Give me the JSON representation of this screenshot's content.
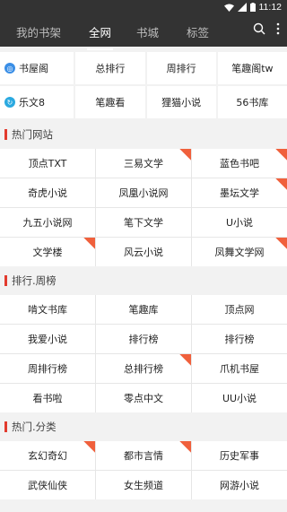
{
  "status": {
    "time": "11:12"
  },
  "nav": {
    "tabs": [
      {
        "label": "我的书架"
      },
      {
        "label": "全网"
      },
      {
        "label": "书城"
      },
      {
        "label": "标签"
      }
    ],
    "active_tab": "全网"
  },
  "quick": {
    "row1": [
      "书屋阁",
      "总排行",
      "周排行",
      "笔趣阁tw"
    ],
    "row2": [
      "乐文8",
      "笔趣看",
      "狸猫小说",
      "56书库"
    ]
  },
  "sections": [
    {
      "title": "热门网站",
      "items": [
        {
          "label": "顶点TXT",
          "hot": false
        },
        {
          "label": "三易文学",
          "hot": true
        },
        {
          "label": "蓝色书吧",
          "hot": true
        },
        {
          "label": "奇虎小说",
          "hot": false
        },
        {
          "label": "凤凰小说网",
          "hot": false
        },
        {
          "label": "墨坛文学",
          "hot": true
        },
        {
          "label": "九五小说网",
          "hot": false
        },
        {
          "label": "笔下文学",
          "hot": false
        },
        {
          "label": "U小说",
          "hot": false
        },
        {
          "label": "文学楼",
          "hot": true
        },
        {
          "label": "风云小说",
          "hot": false
        },
        {
          "label": "凤舞文学网",
          "hot": true
        }
      ]
    },
    {
      "title": "排行.周榜",
      "items": [
        {
          "label": "啃文书库",
          "hot": false
        },
        {
          "label": "笔趣库",
          "hot": false
        },
        {
          "label": "顶点网",
          "hot": false
        },
        {
          "label": "我爱小说",
          "hot": false
        },
        {
          "label": "排行榜",
          "hot": false
        },
        {
          "label": "排行榜",
          "hot": false
        },
        {
          "label": "周排行榜",
          "hot": false
        },
        {
          "label": "总排行榜",
          "hot": true
        },
        {
          "label": "爪机书屋",
          "hot": false
        },
        {
          "label": "看书啦",
          "hot": false
        },
        {
          "label": "零点中文",
          "hot": false
        },
        {
          "label": "UU小说",
          "hot": false
        }
      ]
    },
    {
      "title": "热门.分类",
      "items": [
        {
          "label": "玄幻奇幻",
          "hot": true
        },
        {
          "label": "都市言情",
          "hot": true
        },
        {
          "label": "历史军事",
          "hot": false
        },
        {
          "label": "武侠仙侠",
          "hot": false
        },
        {
          "label": "女生频道",
          "hot": false
        },
        {
          "label": "网游小说",
          "hot": false
        }
      ]
    }
  ],
  "colors": {
    "header_bg": "#333333",
    "accent": "#e23b2e",
    "ribbon": "#f0603c"
  }
}
